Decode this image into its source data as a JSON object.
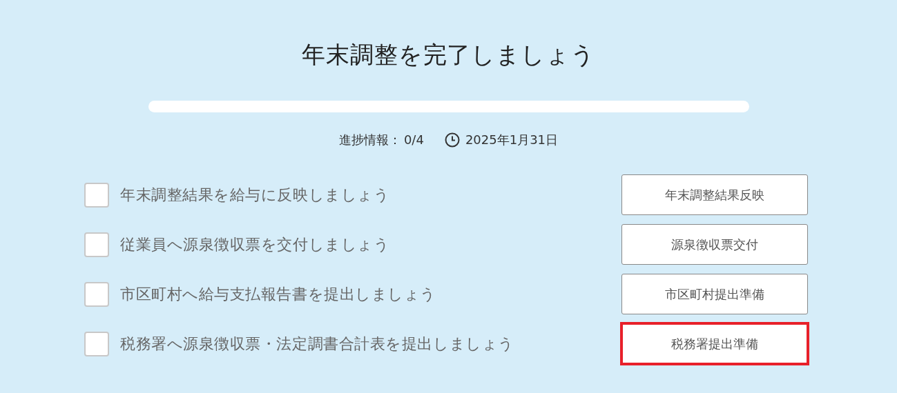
{
  "title": "年末調整を完了しましょう",
  "progress": {
    "level": 0,
    "label": "進捗情報：",
    "count": "0/4",
    "deadline": "2025年1月31日"
  },
  "tasks": [
    {
      "label": "年末調整結果を給与に反映しましょう",
      "checked": false,
      "button": "年末調整結果反映",
      "highlighted": false
    },
    {
      "label": "従業員へ源泉徴収票を交付しましょう",
      "checked": false,
      "button": "源泉徴収票交付",
      "highlighted": false
    },
    {
      "label": "市区町村へ給与支払報告書を提出しましょう",
      "checked": false,
      "button": "市区町村提出準備",
      "highlighted": false
    },
    {
      "label": "税務署へ源泉徴収票・法定調書合計表を提出しましょう",
      "checked": false,
      "button": "税務署提出準備",
      "highlighted": true
    }
  ]
}
